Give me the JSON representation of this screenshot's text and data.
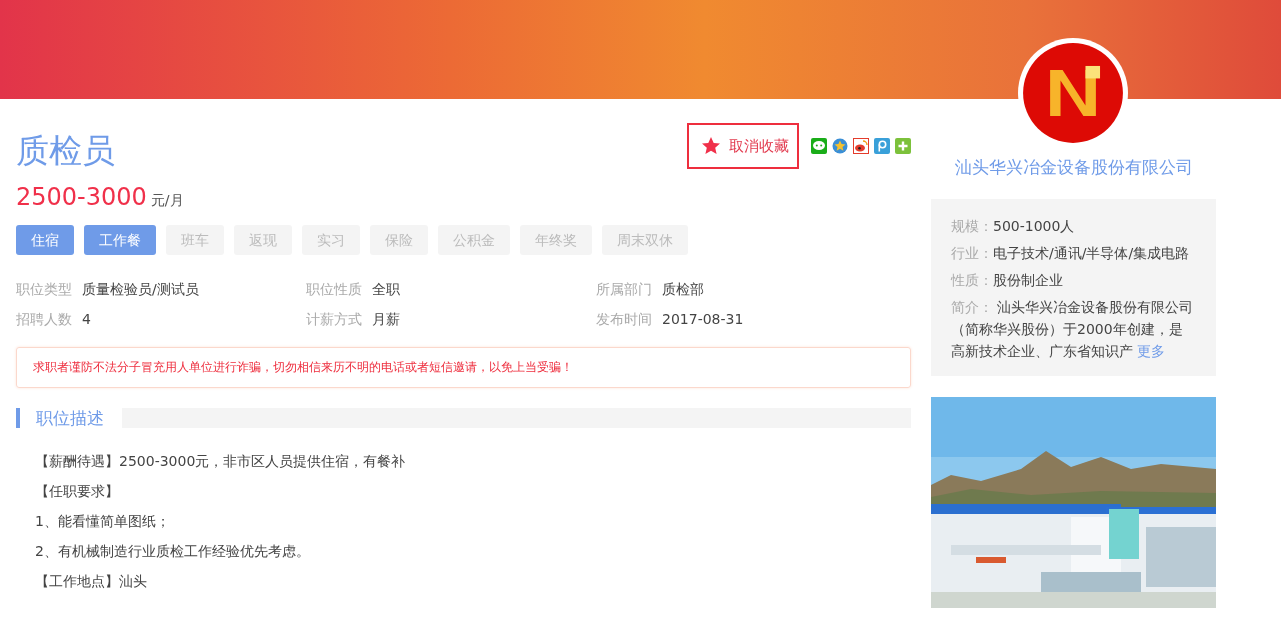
{
  "job": {
    "title": "质检员",
    "salary": "2500-3000",
    "salary_unit": "元/月"
  },
  "favorite": {
    "label": "取消收藏",
    "favorited": true
  },
  "benefits": [
    {
      "label": "住宿",
      "selected": true
    },
    {
      "label": "工作餐",
      "selected": true
    },
    {
      "label": "班车",
      "selected": false
    },
    {
      "label": "返现",
      "selected": false
    },
    {
      "label": "实习",
      "selected": false
    },
    {
      "label": "保险",
      "selected": false
    },
    {
      "label": "公积金",
      "selected": false
    },
    {
      "label": "年终奖",
      "selected": false
    },
    {
      "label": "周末双休",
      "selected": false
    }
  ],
  "details": [
    {
      "label": "职位类型",
      "value": "质量检验员/测试员"
    },
    {
      "label": "职位性质",
      "value": "全职"
    },
    {
      "label": "所属部门",
      "value": "质检部"
    },
    {
      "label": "招聘人数",
      "value": "4"
    },
    {
      "label": "计薪方式",
      "value": "月薪"
    },
    {
      "label": "发布时间",
      "value": "2017-08-31"
    }
  ],
  "warning": "求职者谨防不法分子冒充用人单位进行诈骗，切勿相信来历不明的电话或者短信邀请，以免上当受骗！",
  "section_title": "职位描述",
  "description": [
    "【薪酬待遇】2500-3000元，非市区人员提供住宿，有餐补",
    "【任职要求】",
    "1、能看懂简单图纸；",
    "2、有机械制造行业质检工作经验优先考虑。",
    "【工作地点】汕头"
  ],
  "company": {
    "name": "汕头华兴冶金设备股份有限公司",
    "info": [
      {
        "label": "规模：",
        "value": "500-1000人"
      },
      {
        "label": "行业：",
        "value": "电子技术/通讯/半导体/集成电路"
      },
      {
        "label": "性质：",
        "value": "股份制企业"
      }
    ],
    "intro_label": "简介：",
    "intro": "汕头华兴冶金设备股份有限公司（简称华兴股份）于2000年创建，是高新技术企业、广东省知识产",
    "more_link": "更多"
  }
}
